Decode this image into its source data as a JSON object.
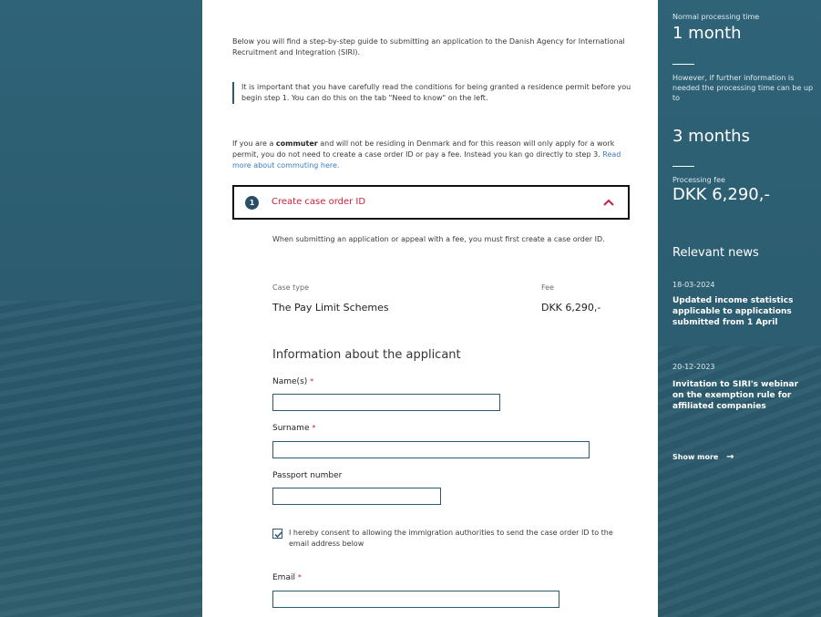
{
  "intro": {
    "guide_text": "Below you will find a step-by-step guide to submitting an application to the Danish Agency for International Recruitment and Integration (SIRI).",
    "callout_text": "It is important that you have carefully read the conditions for being granted a residence permit before you begin step 1. You can do this on the tab \"Need to know\" on the left.",
    "commuter_prefix": "If you are a ",
    "commuter_bold": "commuter",
    "commuter_text": " and will not be residing in Denmark and for this reason will only apply for a work permit, you do not need to create a case order ID or pay a fee. Instead you kan go directly to step 3. ",
    "commuter_link": "Read more about commuting here."
  },
  "step": {
    "number": "1",
    "title": "Create case order ID",
    "description": "When submitting an application or appeal with a fee, you must first create a case order ID.",
    "case_type_label": "Case type",
    "fee_label": "Fee",
    "case_type_value": "The Pay Limit Schemes",
    "fee_value": "DKK 6,290,-"
  },
  "form": {
    "section_title": "Information about the applicant",
    "names_label": "Name(s)",
    "surname_label": "Surname",
    "passport_label": "Passport number",
    "required_mark": "*",
    "consent_text": "I hereby consent to allowing the immigration authorities to send the case order ID to the email address below",
    "consent_checked": true,
    "email_label": "Email",
    "names_value": "",
    "surname_value": "",
    "passport_value": "",
    "email_value": ""
  },
  "sidebar": {
    "normal_label": "Normal processing time",
    "normal_value": "1 month",
    "further_text": "However, if further information is needed the processing time can be up to",
    "max_value": "3 months",
    "fee_label": "Processing fee",
    "fee_value": "DKK 6,290,-",
    "news_title": "Relevant news",
    "news": [
      {
        "date": "18-03-2024",
        "headline": "Updated income statistics applicable to applications submitted from 1 April"
      },
      {
        "date": "20-12-2023",
        "headline": "Invitation to SIRI's webinar on the exemption rule for affiliated companies"
      }
    ],
    "show_more": "Show more",
    "show_more_arrow": "→"
  },
  "colors": {
    "background_teal": "#2c5d70",
    "accent_red": "#c8213b",
    "link_blue": "#3a7cc0",
    "step_circle": "#2b4e66"
  },
  "icons": {
    "chevron": "chevron-up-icon",
    "check": "checkmark-icon",
    "arrow": "arrow-right-icon"
  }
}
